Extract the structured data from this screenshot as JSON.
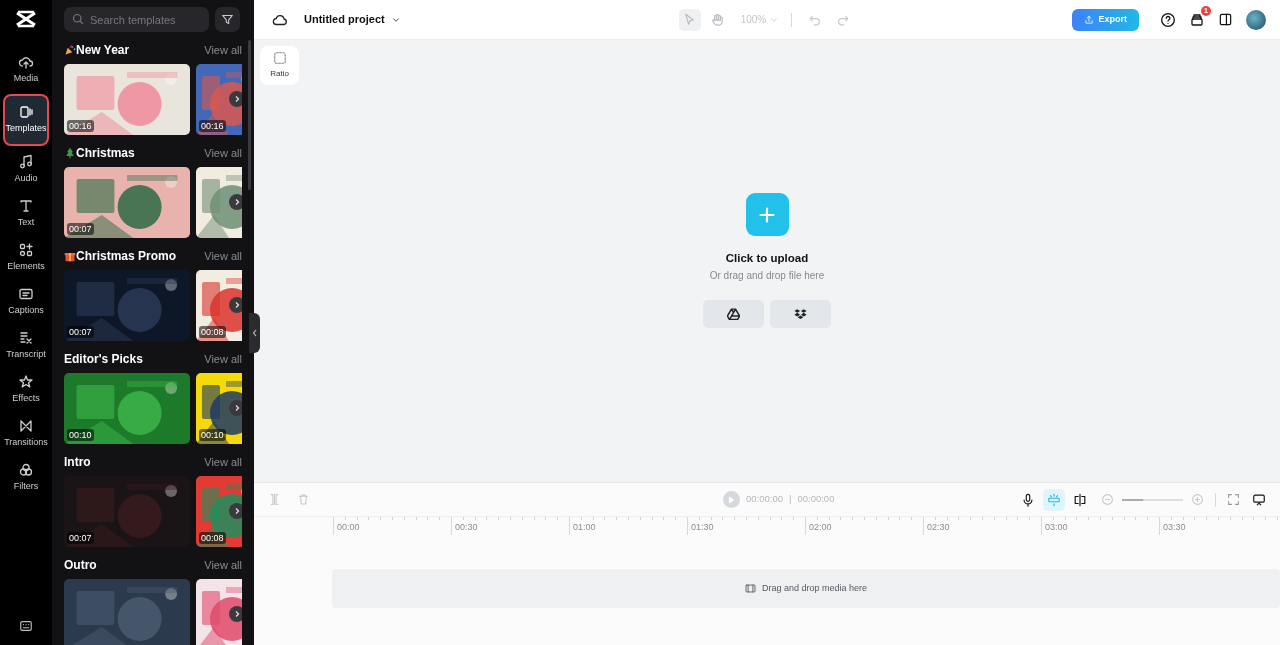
{
  "sidebar": {
    "items": [
      {
        "label": "Media",
        "selected": false
      },
      {
        "label": "Templates",
        "selected": true
      },
      {
        "label": "Audio",
        "selected": false
      },
      {
        "label": "Text",
        "selected": false
      },
      {
        "label": "Elements",
        "selected": false
      },
      {
        "label": "Captions",
        "selected": false
      },
      {
        "label": "Transcript",
        "selected": false
      },
      {
        "label": "Effects",
        "selected": false
      },
      {
        "label": "Transitions",
        "selected": false
      },
      {
        "label": "Filters",
        "selected": false
      }
    ]
  },
  "search": {
    "placeholder": "Search templates"
  },
  "sections": [
    {
      "title": "New Year",
      "view_all": "View all",
      "cards": [
        {
          "kind": "picture",
          "duration": "00:16"
        },
        {
          "kind": "picture",
          "duration": "00:16"
        }
      ]
    },
    {
      "title": "Christmas",
      "view_all": "View all",
      "cards": [
        {
          "kind": "picture",
          "duration": "00:07"
        },
        {
          "kind": "picture"
        }
      ]
    },
    {
      "title": "Christmas Promo",
      "view_all": "View all",
      "cards": [
        {
          "kind": "picture",
          "duration": "00:07"
        },
        {
          "kind": "picture",
          "duration": "00:08"
        }
      ]
    },
    {
      "title": "Editor's Picks",
      "view_all": "View all",
      "cards": [
        {
          "kind": "picture",
          "duration": "00:10"
        },
        {
          "kind": "picture",
          "duration": "00:10"
        }
      ]
    },
    {
      "title": "Intro",
      "view_all": "View all",
      "cards": [
        {
          "kind": "picture",
          "duration": "00:07"
        },
        {
          "kind": "picture",
          "duration": "00:08"
        }
      ]
    },
    {
      "title": "Outro",
      "view_all": "View all",
      "cards": [
        {
          "kind": "picture"
        },
        {
          "kind": "picture"
        }
      ]
    }
  ],
  "project": {
    "title": "Untitled project"
  },
  "canvas_tools": [
    {
      "kind": "pointer",
      "selected": true
    },
    {
      "kind": "hand",
      "selected": false
    }
  ],
  "zoom": "100%",
  "history": [
    {
      "kind": "undo",
      "disabled": true
    },
    {
      "kind": "redo",
      "disabled": true
    }
  ],
  "export": "Export",
  "notifications": {
    "badge": "1"
  },
  "ratio": "Ratio",
  "upload": {
    "title": "Click to upload",
    "subtitle": "Or drag and drop file here"
  },
  "timeline": {
    "current": "00:00:00",
    "separator": "|",
    "total": "00:00:00",
    "snap_on": true,
    "zoom": {
      "level": 0.35
    },
    "ticks": [
      "00:00",
      "00:30",
      "01:00",
      "01:30",
      "02:00",
      "02:30",
      "03:00",
      "03:30"
    ],
    "drop_hint": "Drag and drop media here"
  }
}
